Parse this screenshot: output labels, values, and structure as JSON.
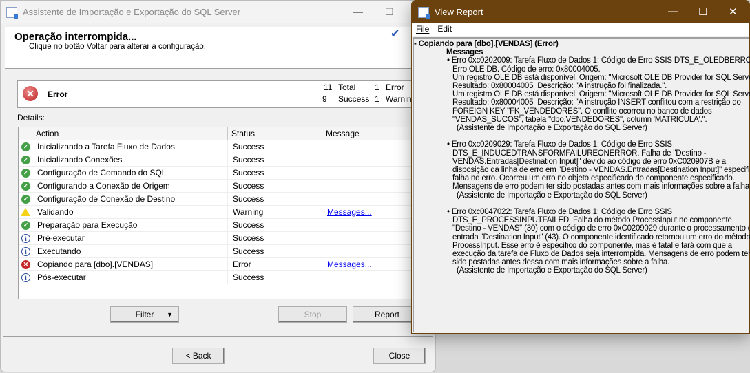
{
  "wizard": {
    "title": "Assistente de Importação e Exportação do SQL Server",
    "header_title": "Operação interrompida...",
    "header_subtitle": "Clique no botão Voltar para alterar a configuração.",
    "summary": {
      "status": "Error",
      "total_count": "11",
      "total_label": "Total",
      "success_count": "9",
      "success_label": "Success",
      "error_count": "1",
      "error_label": "Error",
      "warning_count": "1",
      "warning_label": "Warning"
    },
    "details_label": "Details:",
    "columns": {
      "action": "Action",
      "status": "Status",
      "message": "Message"
    },
    "rows": [
      {
        "icon": "success",
        "action": "Inicializando a Tarefa Fluxo de Dados",
        "status": "Success",
        "message": ""
      },
      {
        "icon": "success",
        "action": "Inicializando Conexões",
        "status": "Success",
        "message": ""
      },
      {
        "icon": "success",
        "action": "Configuração de Comando do SQL",
        "status": "Success",
        "message": ""
      },
      {
        "icon": "success",
        "action": "Configurando a Conexão de Origem",
        "status": "Success",
        "message": ""
      },
      {
        "icon": "success",
        "action": "Configuração de Conexão de Destino",
        "status": "Success",
        "message": ""
      },
      {
        "icon": "warning",
        "action": "Validando",
        "status": "Warning",
        "message": "Messages..."
      },
      {
        "icon": "success",
        "action": "Preparação para Execução",
        "status": "Success",
        "message": ""
      },
      {
        "icon": "info",
        "action": "Pré-executar",
        "status": "Success",
        "message": ""
      },
      {
        "icon": "info",
        "action": "Executando",
        "status": "Success",
        "message": ""
      },
      {
        "icon": "error",
        "action": "Copiando para [dbo].[VENDAS]",
        "status": "Error",
        "message": "Messages..."
      },
      {
        "icon": "info",
        "action": "Pós-executar",
        "status": "Success",
        "message": ""
      }
    ],
    "buttons": {
      "filter": "Filter",
      "stop": "Stop",
      "report": "Report",
      "back": "< Back",
      "close": "Close"
    }
  },
  "report": {
    "title": "View Report",
    "menu": [
      "File",
      "Edit"
    ],
    "section_title": "- Copiando para [dbo].[VENDAS] (Error)",
    "messages_label": "Messages",
    "messages": [
      [
        "• Erro 0xc0202009: Tarefa Fluxo de Dados 1: Código de Erro SSIS DTS_E_OLEDBERROR.",
        "Erro OLE DB. Código de erro: 0x80004005.",
        "Um registro OLE DB está disponível. Origem: \"Microsoft OLE DB Provider for SQL Server\"",
        "Resultado: 0x80004005  Descrição: \"A instrução foi finalizada.\".",
        "Um registro OLE DB está disponível. Origem: \"Microsoft OLE DB Provider for SQL Server\"",
        "Resultado: 0x80004005  Descrição: \"A instrução INSERT conflitou com a restrição do",
        "FOREIGN KEY \"FK_VENDEDORES\". O conflito ocorreu no banco de dados",
        "\"VENDAS_SUCOS\", tabela \"dbo.VENDEDORES\", column 'MATRICULA'.\".",
        "  (Assistente de Importação e Exportação do SQL Server)"
      ],
      [
        "• Erro 0xc0209029: Tarefa Fluxo de Dados 1: Código de Erro SSIS",
        "DTS_E_INDUCEDTRANSFORMFAILUREONERROR. Falha de \"Destino -",
        "VENDAS.Entradas[Destination Input]\" devido ao código de erro 0xC020907B e a",
        "disposição da linha de erro em \"Destino - VENDAS.Entradas[Destination Input]\" especifica",
        "falha no erro. Ocorreu um erro no objeto especificado do componente especificado.",
        "Mensagens de erro podem ter sido postadas antes com mais informações sobre a falha.",
        "  (Assistente de Importação e Exportação do SQL Server)"
      ],
      [
        "• Erro 0xc0047022: Tarefa Fluxo de Dados 1: Código de Erro SSIS",
        "DTS_E_PROCESSINPUTFAILED. Falha do método ProcessInput no componente",
        "\"Destino - VENDAS\" (30) com o código de erro 0xC0209029 durante o processamento da",
        "entrada \"Destination Input\" (43). O componente identificado retornou um erro do método",
        "ProcessInput. Esse erro é específico do componente, mas é fatal e fará com que a",
        "execução da tarefa de Fluxo de Dados seja interrompida. Mensagens de erro podem ter",
        "sido postadas antes dessa com mais informações sobre a falha.",
        "  (Assistente de Importação e Exportação do SQL Server)"
      ]
    ]
  },
  "colors": {
    "report_titlebar": "#6b420e",
    "success": "#43a047",
    "error": "#c62828",
    "warning": "#f5d31a",
    "link": "#0000ee"
  }
}
